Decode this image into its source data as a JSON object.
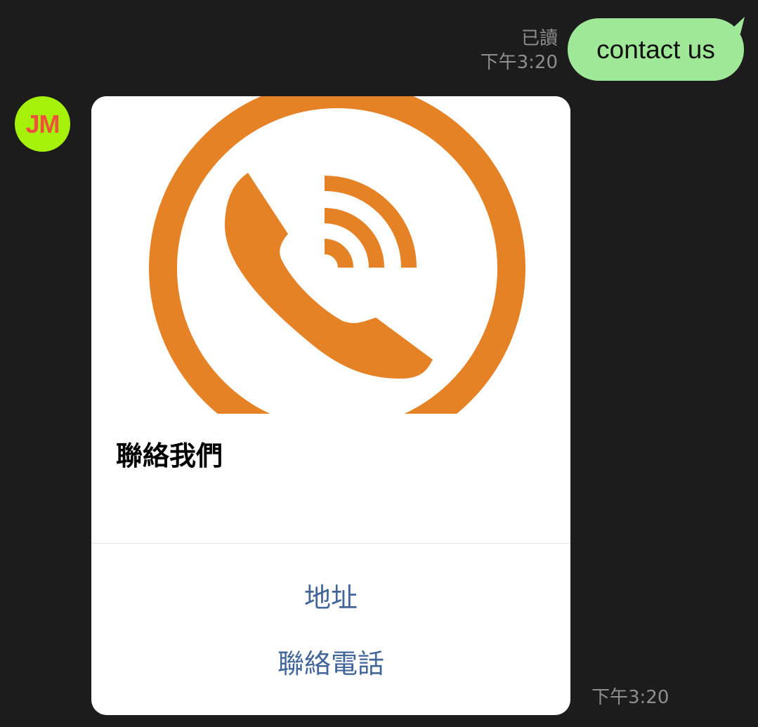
{
  "outgoing": {
    "read_label": "已讀",
    "time": "下午3:20",
    "text": "contact us",
    "bubble_color": "#9fe898"
  },
  "incoming": {
    "avatar_text": "JM",
    "avatar_bg": "#a6f10a",
    "avatar_fg": "#f0513a",
    "time": "下午3:20",
    "card": {
      "hero_icon": "phone-ringing-icon",
      "hero_color": "#e68226",
      "title": "聯絡我們",
      "actions": [
        {
          "label": "地址"
        },
        {
          "label": "聯絡電話"
        }
      ],
      "action_color": "#42659a"
    }
  }
}
